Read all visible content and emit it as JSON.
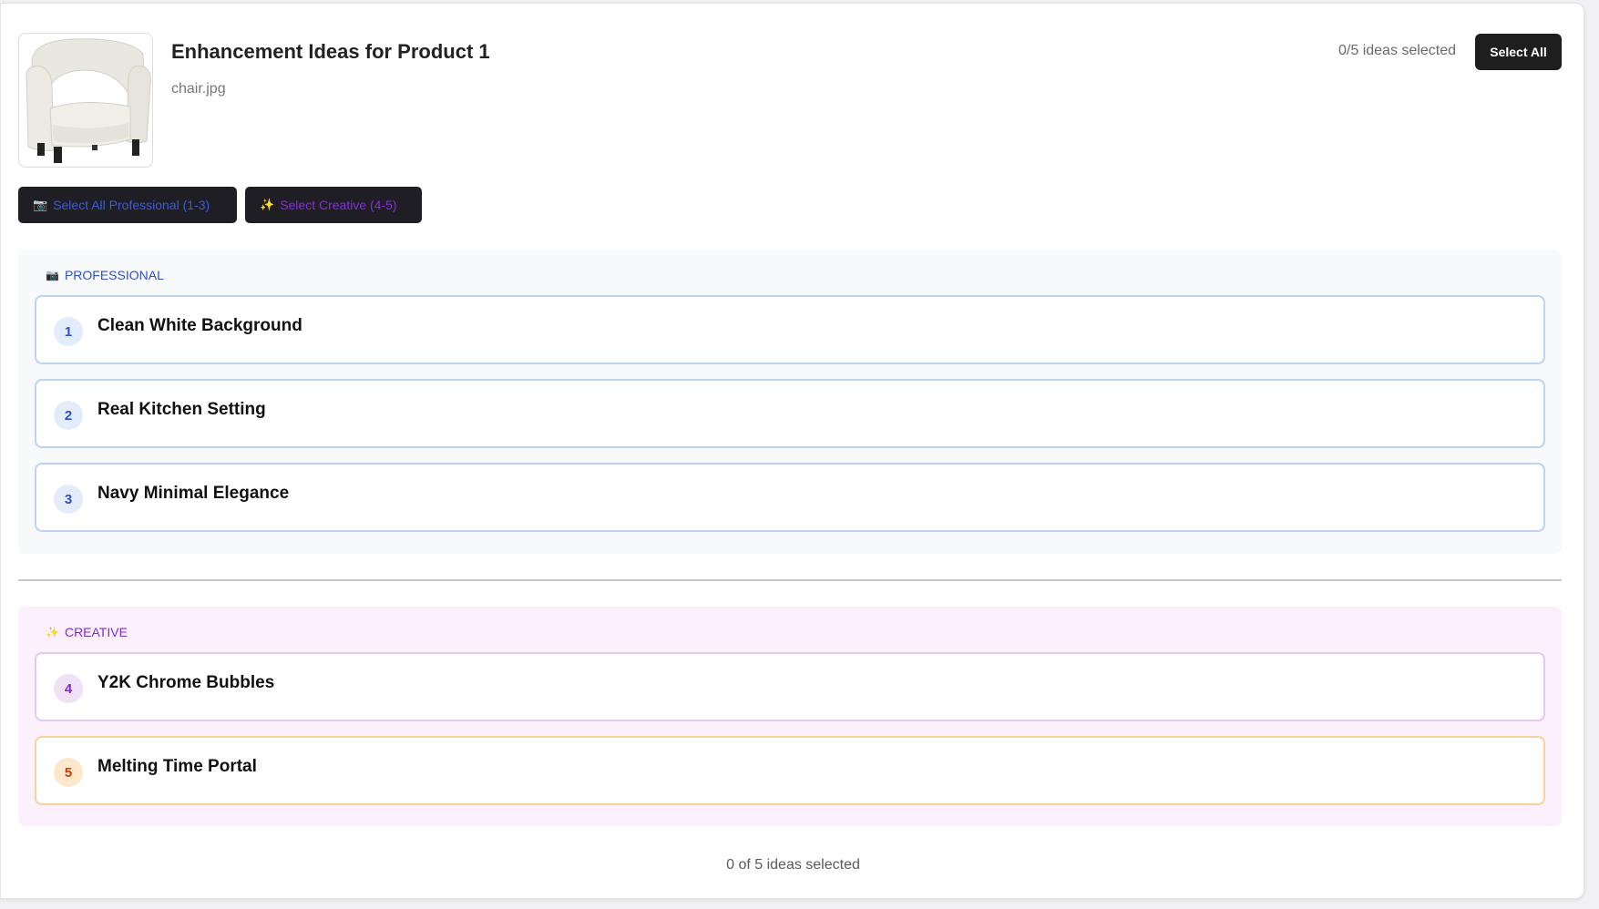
{
  "header": {
    "title": "Enhancement Ideas for Product 1",
    "filename": "chair.jpg",
    "selected_count_text": "0/5 ideas selected",
    "select_all_label": "Select All"
  },
  "quick_select": {
    "professional_icon": "📷",
    "professional_label": "Select All Professional (1-3)",
    "creative_icon": "✨",
    "creative_label": "Select Creative (4-5)"
  },
  "sections": {
    "professional": {
      "icon": "📷",
      "label": "PROFESSIONAL",
      "items": [
        {
          "number": "1",
          "title": "Clean White Background"
        },
        {
          "number": "2",
          "title": "Real Kitchen Setting"
        },
        {
          "number": "3",
          "title": "Navy Minimal Elegance"
        }
      ]
    },
    "creative": {
      "icon": "✨",
      "label": "CREATIVE",
      "items": [
        {
          "number": "4",
          "title": "Y2K Chrome Bubbles"
        },
        {
          "number": "5",
          "title": "Melting Time Portal"
        }
      ]
    }
  },
  "footer": {
    "selected_text": "0 of 5 ideas selected"
  },
  "colors": {
    "professional_accent": "#2f4fc8",
    "creative_accent": "#7e2cc4",
    "orange_accent": "#c2410c",
    "dark_button": "#1e1e1e"
  }
}
